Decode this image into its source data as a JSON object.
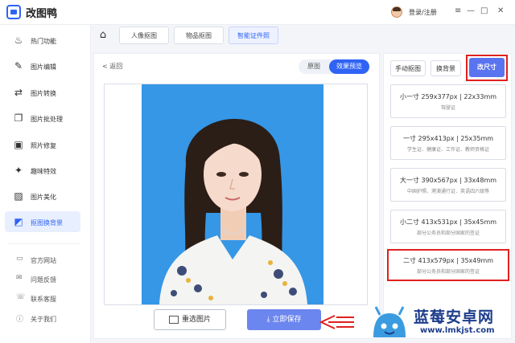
{
  "app": {
    "title": "改图鸭",
    "login": "登录/注册"
  },
  "window": {
    "menu_glyph": "≡",
    "min_glyph": "—",
    "max_glyph": "□",
    "close_glyph": "✕"
  },
  "sidebar": {
    "items": [
      {
        "label": "热门功能",
        "icon": "flame-icon",
        "glyph": "♨"
      },
      {
        "label": "图片编辑",
        "icon": "image-edit-icon",
        "glyph": "✎"
      },
      {
        "label": "图片转换",
        "icon": "convert-icon",
        "glyph": "⇄"
      },
      {
        "label": "图片批处理",
        "icon": "batch-icon",
        "glyph": "❐"
      },
      {
        "label": "照片修复",
        "icon": "repair-icon",
        "glyph": "▣"
      },
      {
        "label": "趣味特效",
        "icon": "sparkle-icon",
        "glyph": "✦"
      },
      {
        "label": "图片美化",
        "icon": "beautify-icon",
        "glyph": "▨"
      },
      {
        "label": "抠图换背景",
        "icon": "cutout-icon",
        "glyph": "◩",
        "active": true
      }
    ],
    "footer": [
      {
        "label": "官方网站",
        "icon": "website-icon",
        "glyph": "▭"
      },
      {
        "label": "问题反馈",
        "icon": "feedback-icon",
        "glyph": "✉"
      },
      {
        "label": "联系客服",
        "icon": "support-icon",
        "glyph": "☏"
      },
      {
        "label": "关于我们",
        "icon": "info-icon",
        "glyph": "ⓘ"
      }
    ]
  },
  "tabs": [
    {
      "label": "人像抠图"
    },
    {
      "label": "物品抠图"
    },
    {
      "label": "智能证件照",
      "active": true
    }
  ],
  "preview": {
    "back": "返回",
    "back_glyph": "<",
    "toggle": {
      "original": "原图",
      "preview": "效果预览",
      "selected": "效果预览"
    },
    "background_color": "#3597e6"
  },
  "actions": {
    "reselect": "重选图片",
    "save": "立即保存"
  },
  "right_panel": {
    "buttons": {
      "manual": "手动抠图",
      "background": "换背景",
      "resize": "改尺寸"
    },
    "sizes": [
      {
        "title": "小一寸 259x377px | 22x33mm",
        "desc": "驾驶证"
      },
      {
        "title": "一寸 295x413px | 25x35mm",
        "desc": "学生证、健康证、工作证、教师资格证"
      },
      {
        "title": "大一寸 390x567px | 33x48mm",
        "desc": "中国护照、港澳通行证、英语四六级等"
      },
      {
        "title": "小二寸 413x531px | 35x45mm",
        "desc": "部分公务员和部分国家的签证"
      },
      {
        "title": "二寸 413x579px | 35x49mm",
        "desc": "部分公务员和部分国家的签证",
        "highlighted": true
      }
    ]
  },
  "watermark": {
    "title": "蓝莓安卓网",
    "url": "www.lmkjst.com"
  },
  "colors": {
    "accent": "#2f63f5",
    "highlight": "#e02020"
  }
}
